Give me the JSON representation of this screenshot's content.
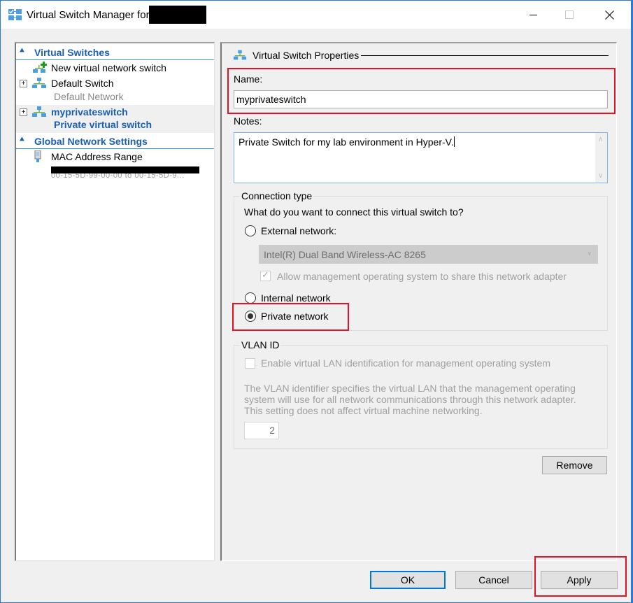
{
  "window": {
    "title": "Virtual Switch Manager for",
    "title_redacted": true,
    "controls": {
      "minimize": "minimize",
      "maximize": "maximize",
      "close": "close"
    }
  },
  "tree": {
    "sections": [
      {
        "label": "Virtual Switches",
        "icon": "chevron-double-up-icon",
        "items": [
          {
            "main": "New virtual network switch",
            "sub": "",
            "icon": "add-switch-icon",
            "expandable": false,
            "selected": false
          },
          {
            "main": "Default Switch",
            "sub": "Default Network",
            "icon": "network-switch-icon",
            "expandable": true,
            "selected": false
          },
          {
            "main": "myprivateswitch",
            "sub": "Private virtual switch",
            "icon": "network-switch-icon",
            "expandable": true,
            "selected": true
          }
        ]
      },
      {
        "label": "Global Network Settings",
        "icon": "chevron-double-up-icon",
        "items": [
          {
            "main": "MAC Address Range",
            "sub": "00-15-5D-99-00-00 to 00-15-5D-9...",
            "icon": "network-adapter-icon",
            "expandable": false,
            "selected": false,
            "sub_redacted": true
          }
        ]
      }
    ]
  },
  "properties": {
    "header": "Virtual Switch Properties",
    "name_label": "Name:",
    "name_value": "myprivateswitch",
    "notes_label": "Notes:",
    "notes_value": "Private Switch for my lab environment in Hyper-V.",
    "connection_type": {
      "group_title": "Connection type",
      "question": "What do you want to connect this virtual switch to?",
      "options": [
        {
          "label": "External network:",
          "checked": false
        },
        {
          "label": "Internal network",
          "checked": false
        },
        {
          "label": "Private network",
          "checked": true
        }
      ],
      "adapter_selected": "Intel(R) Dual Band Wireless-AC 8265",
      "allow_management_label": "Allow management operating system to share this network adapter",
      "allow_management_checked": true
    },
    "vlan": {
      "group_title": "VLAN ID",
      "enable_label": "Enable virtual LAN identification for management operating system",
      "enable_checked": false,
      "description": "The VLAN identifier specifies the virtual LAN that the management operating system will use for all network communications through this network adapter. This setting does not affect virtual machine networking.",
      "vlan_id_value": "2"
    },
    "remove_label": "Remove"
  },
  "footer": {
    "ok_label": "OK",
    "cancel_label": "Cancel",
    "apply_label": "Apply"
  },
  "highlight_color": "#e81123",
  "accent_color": "#1a5fb4"
}
